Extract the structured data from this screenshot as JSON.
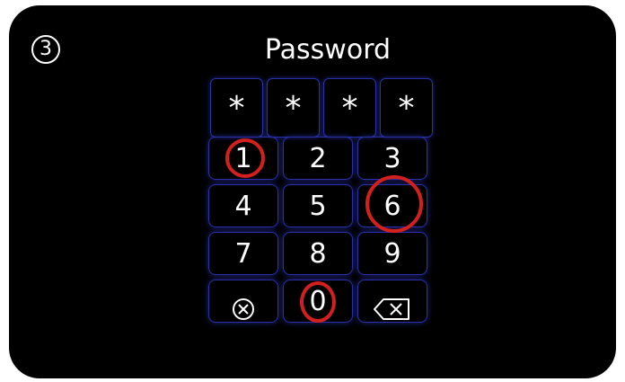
{
  "step_badge": "3",
  "title": "Password",
  "password_mask": [
    "*",
    "*",
    "*",
    "*"
  ],
  "keypad": {
    "keys": [
      "1",
      "2",
      "3",
      "4",
      "5",
      "6",
      "7",
      "8",
      "9",
      "⊗",
      "0",
      "⌫"
    ],
    "clear_icon": "clear-circle-x-icon",
    "backspace_icon": "backspace-icon"
  },
  "highlighted_keys": [
    "1",
    "6",
    "0"
  ],
  "colors": {
    "background": "#000000",
    "key_border": "#2a31a8",
    "highlight": "#d2201e",
    "text": "#ffffff"
  }
}
